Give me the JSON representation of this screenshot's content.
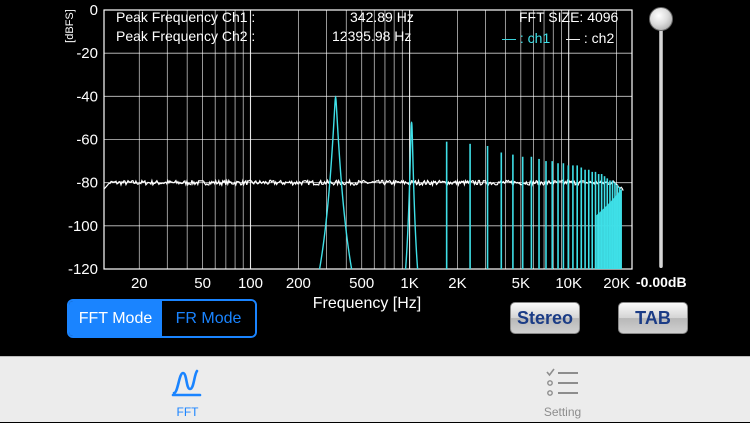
{
  "chart_data": {
    "type": "line",
    "xscale": "log",
    "xlabel": "Frequency [Hz]",
    "ylabel": "[dBFS]",
    "xlim": [
      12,
      25000
    ],
    "ylim": [
      -120,
      0
    ],
    "grid": true,
    "yticks": [
      0,
      -20,
      -40,
      -60,
      -80,
      -100,
      -120
    ],
    "ytick_labels": [
      "0",
      "-20",
      "-40",
      "-60",
      "-80",
      "-100",
      "-120"
    ],
    "xticks": [
      20,
      50,
      100,
      200,
      500,
      1000,
      2000,
      5000,
      10000,
      20000
    ],
    "xtick_labels": [
      "20",
      "50",
      "100",
      "200",
      "500",
      "1K",
      "2K",
      "5K",
      "10K",
      "20K"
    ],
    "series": [
      {
        "name": "ch1",
        "color": "#3fe0e8",
        "peaks": [
          {
            "freq": 342.89,
            "db": -40
          },
          {
            "freq": 1030,
            "db": -52
          },
          {
            "freq": 1710,
            "db": -61
          },
          {
            "freq": 2400,
            "db": -62
          },
          {
            "freq": 3090,
            "db": -63
          },
          {
            "freq": 3770,
            "db": -66
          },
          {
            "freq": 4460,
            "db": -67
          },
          {
            "freq": 5140,
            "db": -68
          },
          {
            "freq": 5830,
            "db": -68
          },
          {
            "freq": 6510,
            "db": -69
          },
          {
            "freq": 7200,
            "db": -70
          },
          {
            "freq": 7880,
            "db": -70
          },
          {
            "freq": 8570,
            "db": -71
          },
          {
            "freq": 9260,
            "db": -71
          },
          {
            "freq": 9940,
            "db": -72
          },
          {
            "freq": 10630,
            "db": -72
          },
          {
            "freq": 11310,
            "db": -72
          },
          {
            "freq": 12000,
            "db": -73
          },
          {
            "freq": 12680,
            "db": -74
          },
          {
            "freq": 13370,
            "db": -74
          },
          {
            "freq": 14060,
            "db": -75
          },
          {
            "freq": 14740,
            "db": -75
          },
          {
            "freq": 15430,
            "db": -76
          },
          {
            "freq": 16110,
            "db": -76
          },
          {
            "freq": 16800,
            "db": -77
          },
          {
            "freq": 17480,
            "db": -78
          },
          {
            "freq": 18170,
            "db": -79
          },
          {
            "freq": 18860,
            "db": -79
          },
          {
            "freq": 19540,
            "db": -80
          },
          {
            "freq": 20230,
            "db": -81
          },
          {
            "freq": 20910,
            "db": -82
          }
        ]
      },
      {
        "name": "ch2",
        "color": "#ffffff",
        "noise_floor_db": -80
      }
    ]
  },
  "readouts": {
    "peak_ch1_label": "Peak Frequency Ch1 :",
    "peak_ch1_value": "342.89 Hz",
    "peak_ch2_label": "Peak Frequency Ch2 :",
    "peak_ch2_value": "12395.98 Hz",
    "fft_size": "FFT SIZE: 4096",
    "legend_ch1": "— : ch1",
    "legend_ch2": "— : ch2"
  },
  "mode": {
    "fft_label": "FFT Mode",
    "fr_label": "FR Mode",
    "selected": "FFT Mode"
  },
  "buttons": {
    "stereo": "Stereo",
    "tab": "TAB"
  },
  "gain_slider": {
    "value_label": "-0.00dB",
    "level": 1.0
  },
  "tabbar": {
    "fft": {
      "label": "FFT",
      "icon": "waveform-icon"
    },
    "setting": {
      "label": "Setting",
      "icon": "checklist-icon"
    }
  },
  "colors": {
    "accent": "#1a84ff",
    "ch1": "#3fe0e8",
    "ch2": "#ffffff",
    "grid": "#ffffff"
  }
}
